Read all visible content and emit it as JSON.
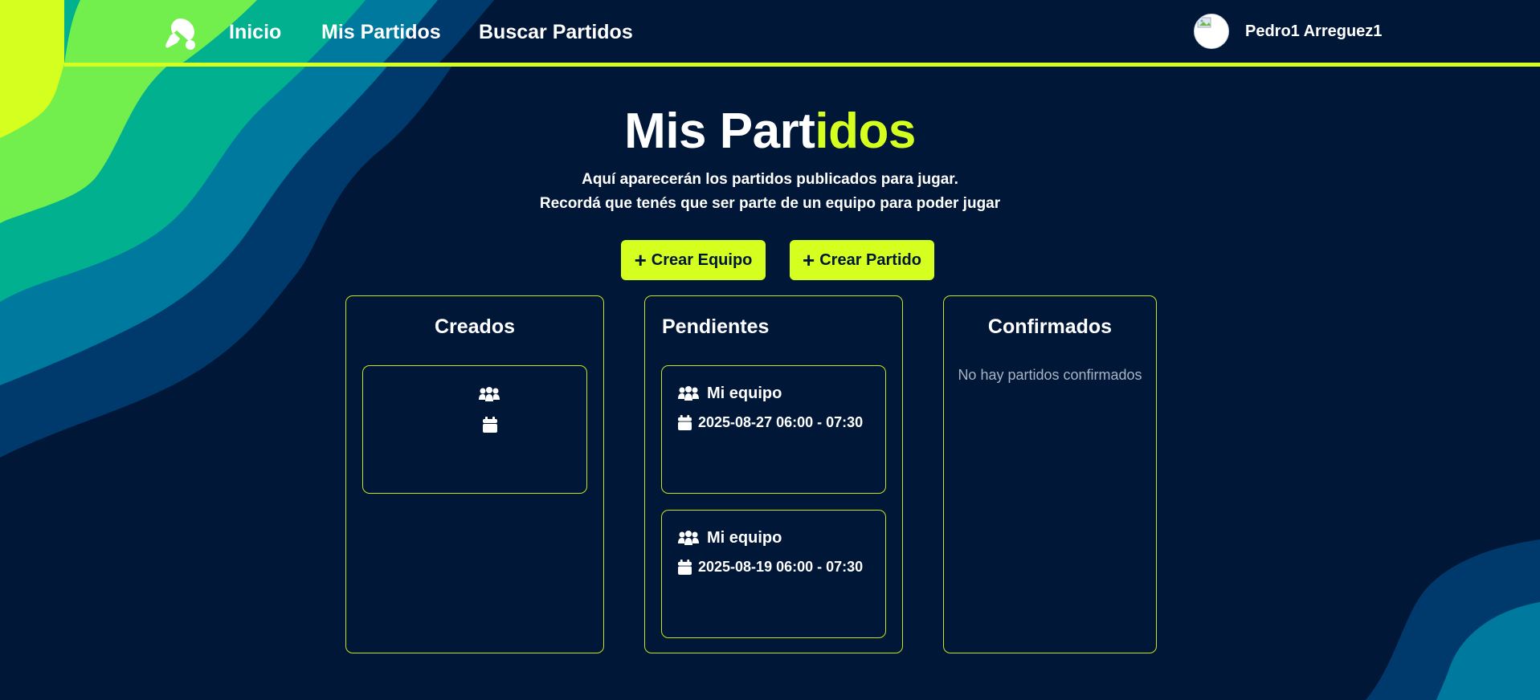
{
  "navbar": {
    "logo": "ping-pong-paddle-icon",
    "links": {
      "inicio": "Inicio",
      "mis_partidos": "Mis Partidos",
      "buscar_partidos": "Buscar Partidos"
    },
    "user": {
      "name": "Pedro1 Arreguez1",
      "avatar": "broken-image-avatar"
    }
  },
  "hero": {
    "title_main": "Mis Part",
    "title_accent": "idos",
    "subtitle_line1": "Aquí aparecerán los partidos publicados para jugar.",
    "subtitle_line2": "Recordá que tenés que ser parte de un equipo para poder jugar"
  },
  "actions": {
    "crear_equipo": "Crear Equipo",
    "crear_partido": "Crear Partido",
    "plus_icon": "+"
  },
  "columns": {
    "creados": {
      "title": "Creados",
      "cards": [
        {
          "team": "",
          "datetime": ""
        }
      ]
    },
    "pendientes": {
      "title": "Pendientes",
      "cards": [
        {
          "team": "Mi equipo",
          "datetime": "2025-08-27 06:00 - 07:30"
        },
        {
          "team": "Mi equipo",
          "datetime": "2025-08-19 06:00 - 07:30"
        }
      ]
    },
    "confirmados": {
      "title": "Confirmados",
      "empty_message": "No hay partidos confirmados"
    }
  },
  "icons": {
    "team": "users-icon",
    "date": "calendar-icon"
  },
  "colors": {
    "background": "#001737",
    "accent": "#d4ff1f",
    "wave_lime": "#72ee4d",
    "wave_teal": "#00b08e",
    "wave_blue": "#00799f",
    "wave_navy": "#003a6c"
  }
}
